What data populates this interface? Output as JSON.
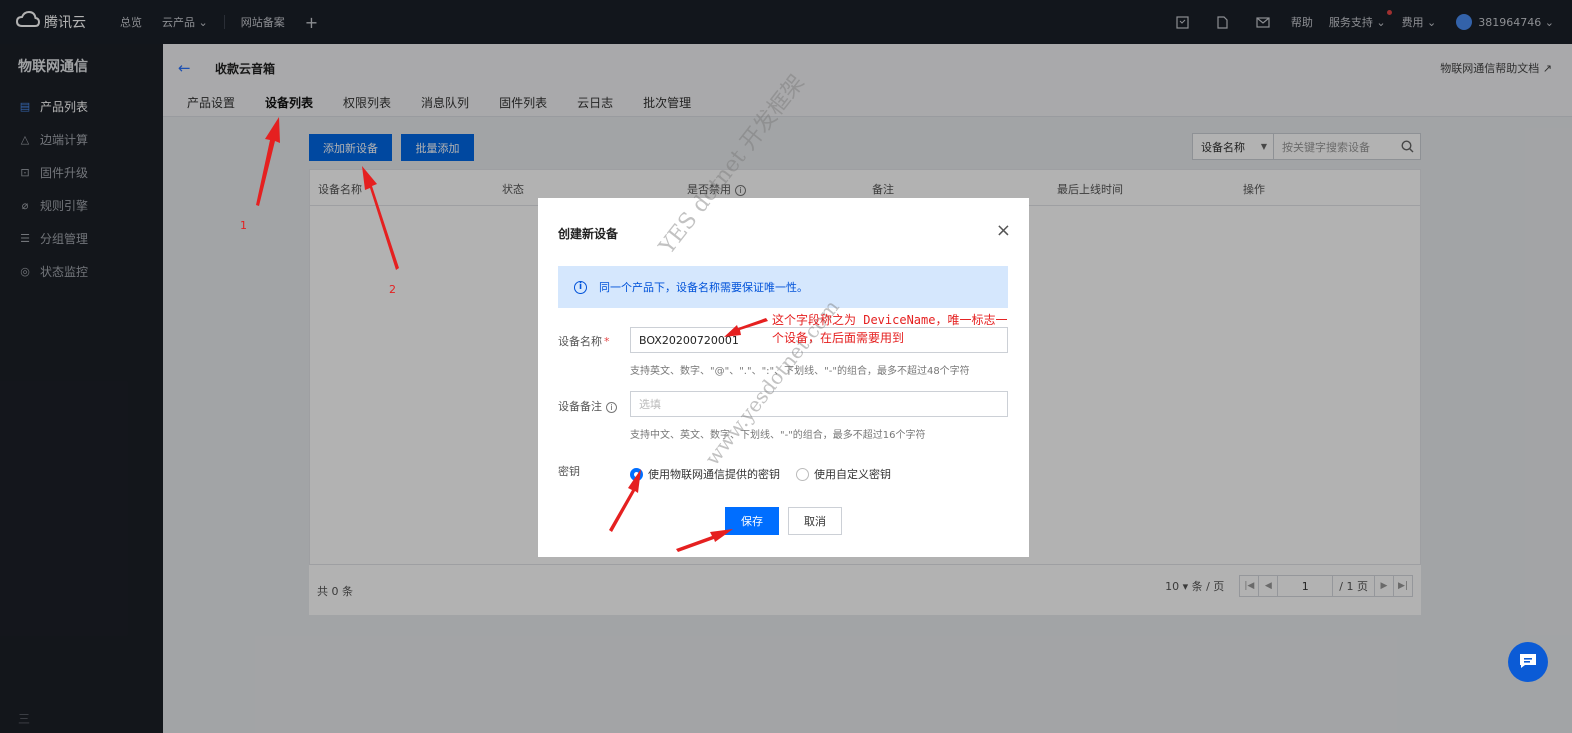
{
  "topbar": {
    "brand": "腾讯云",
    "nav": [
      "总览",
      "云产品",
      "网站备案"
    ],
    "plus": "+",
    "right": {
      "help": "帮助",
      "service": "服务支持",
      "billing": "费用",
      "user": "381964746"
    }
  },
  "sidebar": {
    "title": "物联网通信",
    "items": [
      {
        "label": "产品列表",
        "icon": "list-icon"
      },
      {
        "label": "边端计算",
        "icon": "edge-icon"
      },
      {
        "label": "固件升级",
        "icon": "upgrade-icon"
      },
      {
        "label": "规则引擎",
        "icon": "link-icon"
      },
      {
        "label": "分组管理",
        "icon": "group-icon"
      },
      {
        "label": "状态监控",
        "icon": "monitor-icon"
      }
    ],
    "bottom": "三"
  },
  "header": {
    "title": "收款云音箱",
    "help_doc": "物联网通信帮助文档",
    "tabs": [
      "产品设置",
      "设备列表",
      "权限列表",
      "消息队列",
      "固件列表",
      "云日志",
      "批次管理"
    ],
    "active_tab": "设备列表"
  },
  "toolbar": {
    "add_device": "添加新设备",
    "batch_add": "批量添加",
    "search_select": "设备名称",
    "search_placeholder": "按关键字搜索设备"
  },
  "table": {
    "columns": [
      "设备名称",
      "状态",
      "是否禁用",
      "备注",
      "最后上线时间",
      "操作"
    ]
  },
  "pagination": {
    "total": "共 0 条",
    "page_size": "10 ▾  条 / 页",
    "current": "1",
    "total_pages": "/ 1 页"
  },
  "dialog": {
    "title": "创建新设备",
    "close": "×",
    "info": "同一个产品下，设备名称需要保证唯一性。",
    "device_name_label": "设备名称",
    "required_mark": "*",
    "device_name_value": "BOX20200720001",
    "device_name_hint": "支持英文、数字、\"@\"、\".\"、\":\"、下划线、\"-\"的组合，最多不超过48个字符",
    "remark_label": "设备备注",
    "remark_placeholder": "选填",
    "remark_hint": "支持中文、英文、数字、下划线、\"-\"的组合，最多不超过16个字符",
    "key_label": "密钥",
    "key_options": [
      "使用物联网通信提供的密钥",
      "使用自定义密钥"
    ],
    "save": "保存",
    "cancel": "取消"
  },
  "annotations": {
    "note_line1": "这个字段称之为 DeviceName，唯一标志一",
    "note_line2": "个设备，在后面需要用到",
    "num1": "1",
    "num2": "2",
    "watermark": "YES dotnet 开发框架",
    "watermark2": "www.yesdotnet.com"
  },
  "colors": {
    "primary": "#006eff",
    "annotation": "#e52020"
  }
}
